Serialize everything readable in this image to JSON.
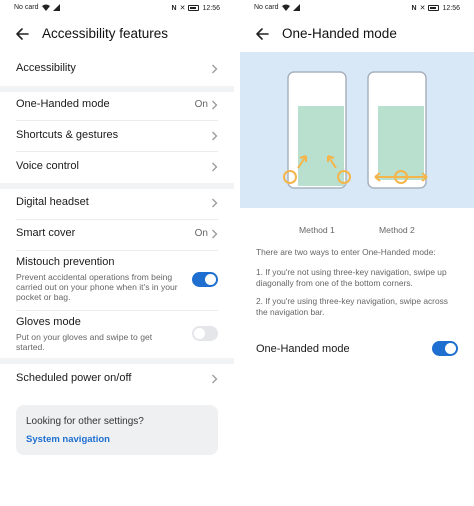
{
  "status_bar": {
    "carrier": "No card",
    "time": "12:56"
  },
  "left": {
    "title": "Accessibility features",
    "items": [
      {
        "label": "Accessibility",
        "value": ""
      },
      {
        "label": "One-Handed mode",
        "value": "On"
      },
      {
        "label": "Shortcuts & gestures",
        "value": ""
      },
      {
        "label": "Voice control",
        "value": ""
      },
      {
        "label": "Digital headset",
        "value": ""
      },
      {
        "label": "Smart cover",
        "value": "On"
      },
      {
        "label": "Mistouch prevention",
        "sub": "Prevent accidental operations from being carried out on your phone when it's in your pocket or bag.",
        "toggle": "on"
      },
      {
        "label": "Gloves mode",
        "sub": "Put on your gloves and swipe to get started.",
        "toggle": "off"
      },
      {
        "label": "Scheduled power on/off",
        "value": ""
      }
    ],
    "card": {
      "question": "Looking for other settings?",
      "link": "System navigation"
    }
  },
  "right": {
    "title": "One-Handed mode",
    "method1": "Method 1",
    "method2": "Method 2",
    "intro": "There are two ways to enter One-Handed mode:",
    "step1": "1. If you're not using three-key navigation, swipe up diagonally from one of the bottom corners.",
    "step2": "2. If you're using three-key navigation, swipe across the navigation bar.",
    "toggle_label": "One-Handed mode",
    "toggle_state": "on"
  },
  "colors": {
    "accent": "#1f6fd1",
    "illustration_bg": "#d8e8f7",
    "overlay": "#b9e0cf",
    "gesture": "#f5b54a",
    "phone_border": "#a9b3bf"
  }
}
